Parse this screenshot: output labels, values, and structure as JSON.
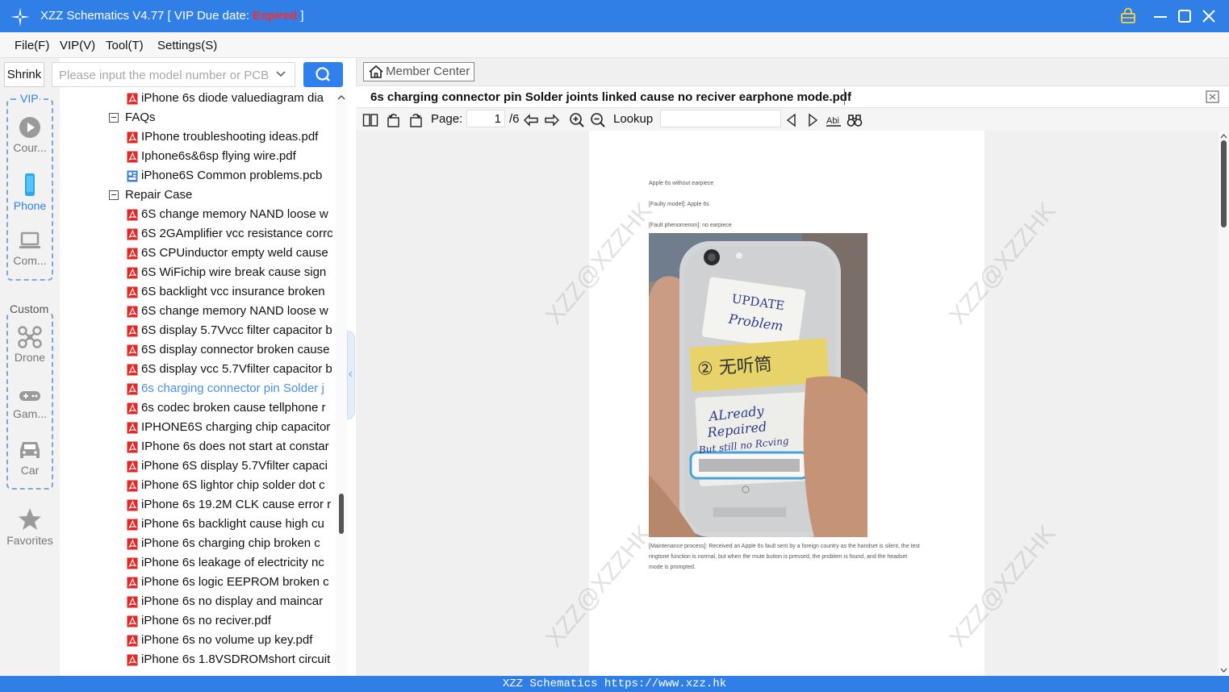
{
  "titlebar": {
    "title_prefix": "XZZ Schematics V4.77 [ VIP Due date: ",
    "title_status": "Expired",
    "title_suffix": " ]"
  },
  "menu": [
    "File(F)",
    "VIP(V)",
    "Tool(T)",
    "Settings(S)"
  ],
  "search": {
    "shrink_label": "Shrink",
    "placeholder": "Please input the model number or PCB"
  },
  "nav": {
    "vip_label": "VIP",
    "custom_label": "Custom",
    "vip_items": [
      {
        "label": "Cour...",
        "icon": "play-circle-icon"
      },
      {
        "label": "Phone",
        "icon": "phone-icon"
      },
      {
        "label": "Com...",
        "icon": "laptop-icon"
      }
    ],
    "custom_items": [
      {
        "label": "Drone",
        "icon": "drone-icon"
      },
      {
        "label": "Gam...",
        "icon": "gamepad-icon"
      },
      {
        "label": "Car",
        "icon": "car-icon"
      }
    ],
    "favorites_label": "Favorites"
  },
  "tree": [
    {
      "type": "file",
      "icon": "pdf",
      "label": "iPhone 6s diode valuediagram dia"
    },
    {
      "type": "folder",
      "label": "FAQs"
    },
    {
      "type": "file",
      "icon": "pdf",
      "label": "IPhone troubleshooting ideas.pdf"
    },
    {
      "type": "file",
      "icon": "pdf",
      "label": "Iphone6s&6sp flying wire.pdf"
    },
    {
      "type": "file",
      "icon": "pcb",
      "label": "iPhone6S Common problems.pcb"
    },
    {
      "type": "folder",
      "label": "Repair Case"
    },
    {
      "type": "file",
      "icon": "pdf",
      "label": "6S  change memory NAND loose w"
    },
    {
      "type": "file",
      "icon": "pdf",
      "label": "6S 2GAmplifier vcc resistance corrc"
    },
    {
      "type": "file",
      "icon": "pdf",
      "label": "6S CPUinductor empty weld cause"
    },
    {
      "type": "file",
      "icon": "pdf",
      "label": "6S WiFichip wire break  cause sign"
    },
    {
      "type": "file",
      "icon": "pdf",
      "label": "6S backlight vcc insurance broken"
    },
    {
      "type": "file",
      "icon": "pdf",
      "label": "6S change memory NAND loose w"
    },
    {
      "type": "file",
      "icon": "pdf",
      "label": "6S display 5.7Vvcc filter capacitor b"
    },
    {
      "type": "file",
      "icon": "pdf",
      "label": "6S display connector broken cause"
    },
    {
      "type": "file",
      "icon": "pdf",
      "label": "6S display vcc 5.7Vfilter capacitor b"
    },
    {
      "type": "file",
      "icon": "pdf",
      "label": "6s charging connector pin Solder j",
      "selected": true
    },
    {
      "type": "file",
      "icon": "pdf",
      "label": "6s codec broken cause tellphone r"
    },
    {
      "type": "file",
      "icon": "pdf",
      "label": "IPHONE6S charging chip capacitor"
    },
    {
      "type": "file",
      "icon": "pdf",
      "label": "IPhone 6s does not start at constar"
    },
    {
      "type": "file",
      "icon": "pdf",
      "label": "iPhone 6S display 5.7Vfilter capaci"
    },
    {
      "type": "file",
      "icon": "pdf",
      "label": "iPhone 6S lightor chip solder dot c"
    },
    {
      "type": "file",
      "icon": "pdf",
      "label": "iPhone 6s  19.2M CLK cause error r"
    },
    {
      "type": "file",
      "icon": "pdf",
      "label": "iPhone 6s  backlight cause high cu"
    },
    {
      "type": "file",
      "icon": "pdf",
      "label": "iPhone 6s  charging chip broken c"
    },
    {
      "type": "file",
      "icon": "pdf",
      "label": "iPhone 6s  leakage of electricity nc"
    },
    {
      "type": "file",
      "icon": "pdf",
      "label": "iPhone 6s  logic EEPROM broken c"
    },
    {
      "type": "file",
      "icon": "pdf",
      "label": "iPhone 6s  no display and maincar"
    },
    {
      "type": "file",
      "icon": "pdf",
      "label": "iPhone 6s  no reciver.pdf"
    },
    {
      "type": "file",
      "icon": "pdf",
      "label": "iPhone 6s  no volume up key.pdf"
    },
    {
      "type": "file",
      "icon": "pdf",
      "label": "iPhone 6s 1.8VSDROMshort circuit"
    }
  ],
  "member_center": "Member Center",
  "doc": {
    "tab_title": "6s charging connector pin Solder joints linked cause no reciver earphone mode.pdf",
    "page_label": "Page:",
    "page_current": "1",
    "page_total": "/6",
    "lookup_label": "Lookup"
  },
  "page_content": {
    "line1": "Apple 6s without earpiece",
    "line2": "[Faulty model]: Apple 6s",
    "line3": "[Fault phenomenon]: no earpiece",
    "process_lines": [
      "[Maintenance process]: Received an Apple 6s fault sent by a foreign country as the handset is silent, the test",
      "ringtone function is normal, but when the mute button is pressed, the problem is found, and the headset",
      "mode is prompted."
    ],
    "note_update": "UPDATE",
    "note_problem": "Problem",
    "note_chinese": "② 无听筒",
    "note_repaired_1": "ALready",
    "note_repaired_2": "Repaired",
    "note_repaired_3": "But still no Rcving",
    "watermark": "XZZ@XZZHK"
  },
  "status_bar": "XZZ Schematics https://www.xzz.hk",
  "colors": {
    "accent": "#2f7fe6",
    "expired": "#ff2a2a",
    "selected": "#4a8fe7",
    "pdf_red": "#e02a2a"
  }
}
